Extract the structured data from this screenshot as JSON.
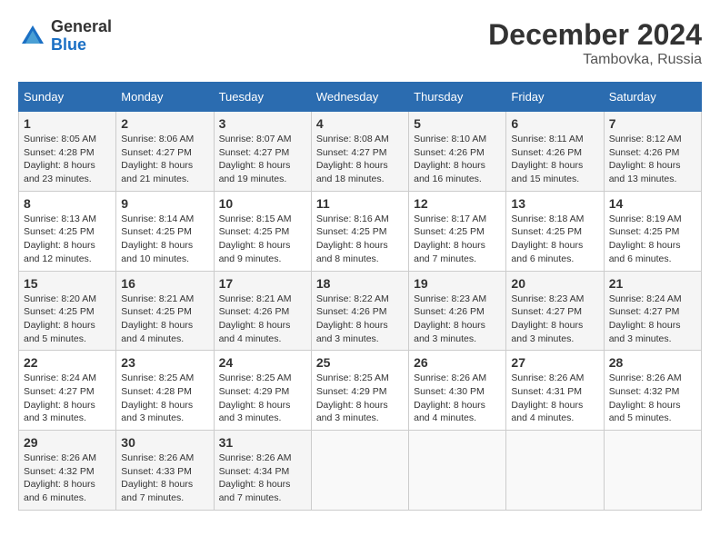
{
  "header": {
    "logo_general": "General",
    "logo_blue": "Blue",
    "month_title": "December 2024",
    "location": "Tambovka, Russia"
  },
  "calendar": {
    "days_of_week": [
      "Sunday",
      "Monday",
      "Tuesday",
      "Wednesday",
      "Thursday",
      "Friday",
      "Saturday"
    ],
    "weeks": [
      [
        {
          "day": "",
          "info": ""
        },
        {
          "day": "2",
          "sunrise": "Sunrise: 8:06 AM",
          "sunset": "Sunset: 4:27 PM",
          "daylight": "Daylight: 8 hours and 21 minutes."
        },
        {
          "day": "3",
          "sunrise": "Sunrise: 8:07 AM",
          "sunset": "Sunset: 4:27 PM",
          "daylight": "Daylight: 8 hours and 19 minutes."
        },
        {
          "day": "4",
          "sunrise": "Sunrise: 8:08 AM",
          "sunset": "Sunset: 4:27 PM",
          "daylight": "Daylight: 8 hours and 18 minutes."
        },
        {
          "day": "5",
          "sunrise": "Sunrise: 8:10 AM",
          "sunset": "Sunset: 4:26 PM",
          "daylight": "Daylight: 8 hours and 16 minutes."
        },
        {
          "day": "6",
          "sunrise": "Sunrise: 8:11 AM",
          "sunset": "Sunset: 4:26 PM",
          "daylight": "Daylight: 8 hours and 15 minutes."
        },
        {
          "day": "7",
          "sunrise": "Sunrise: 8:12 AM",
          "sunset": "Sunset: 4:26 PM",
          "daylight": "Daylight: 8 hours and 13 minutes."
        }
      ],
      [
        {
          "day": "8",
          "sunrise": "Sunrise: 8:13 AM",
          "sunset": "Sunset: 4:25 PM",
          "daylight": "Daylight: 8 hours and 12 minutes."
        },
        {
          "day": "9",
          "sunrise": "Sunrise: 8:14 AM",
          "sunset": "Sunset: 4:25 PM",
          "daylight": "Daylight: 8 hours and 10 minutes."
        },
        {
          "day": "10",
          "sunrise": "Sunrise: 8:15 AM",
          "sunset": "Sunset: 4:25 PM",
          "daylight": "Daylight: 8 hours and 9 minutes."
        },
        {
          "day": "11",
          "sunrise": "Sunrise: 8:16 AM",
          "sunset": "Sunset: 4:25 PM",
          "daylight": "Daylight: 8 hours and 8 minutes."
        },
        {
          "day": "12",
          "sunrise": "Sunrise: 8:17 AM",
          "sunset": "Sunset: 4:25 PM",
          "daylight": "Daylight: 8 hours and 7 minutes."
        },
        {
          "day": "13",
          "sunrise": "Sunrise: 8:18 AM",
          "sunset": "Sunset: 4:25 PM",
          "daylight": "Daylight: 8 hours and 6 minutes."
        },
        {
          "day": "14",
          "sunrise": "Sunrise: 8:19 AM",
          "sunset": "Sunset: 4:25 PM",
          "daylight": "Daylight: 8 hours and 6 minutes."
        }
      ],
      [
        {
          "day": "15",
          "sunrise": "Sunrise: 8:20 AM",
          "sunset": "Sunset: 4:25 PM",
          "daylight": "Daylight: 8 hours and 5 minutes."
        },
        {
          "day": "16",
          "sunrise": "Sunrise: 8:21 AM",
          "sunset": "Sunset: 4:25 PM",
          "daylight": "Daylight: 8 hours and 4 minutes."
        },
        {
          "day": "17",
          "sunrise": "Sunrise: 8:21 AM",
          "sunset": "Sunset: 4:26 PM",
          "daylight": "Daylight: 8 hours and 4 minutes."
        },
        {
          "day": "18",
          "sunrise": "Sunrise: 8:22 AM",
          "sunset": "Sunset: 4:26 PM",
          "daylight": "Daylight: 8 hours and 3 minutes."
        },
        {
          "day": "19",
          "sunrise": "Sunrise: 8:23 AM",
          "sunset": "Sunset: 4:26 PM",
          "daylight": "Daylight: 8 hours and 3 minutes."
        },
        {
          "day": "20",
          "sunrise": "Sunrise: 8:23 AM",
          "sunset": "Sunset: 4:27 PM",
          "daylight": "Daylight: 8 hours and 3 minutes."
        },
        {
          "day": "21",
          "sunrise": "Sunrise: 8:24 AM",
          "sunset": "Sunset: 4:27 PM",
          "daylight": "Daylight: 8 hours and 3 minutes."
        }
      ],
      [
        {
          "day": "22",
          "sunrise": "Sunrise: 8:24 AM",
          "sunset": "Sunset: 4:27 PM",
          "daylight": "Daylight: 8 hours and 3 minutes."
        },
        {
          "day": "23",
          "sunrise": "Sunrise: 8:25 AM",
          "sunset": "Sunset: 4:28 PM",
          "daylight": "Daylight: 8 hours and 3 minutes."
        },
        {
          "day": "24",
          "sunrise": "Sunrise: 8:25 AM",
          "sunset": "Sunset: 4:29 PM",
          "daylight": "Daylight: 8 hours and 3 minutes."
        },
        {
          "day": "25",
          "sunrise": "Sunrise: 8:25 AM",
          "sunset": "Sunset: 4:29 PM",
          "daylight": "Daylight: 8 hours and 3 minutes."
        },
        {
          "day": "26",
          "sunrise": "Sunrise: 8:26 AM",
          "sunset": "Sunset: 4:30 PM",
          "daylight": "Daylight: 8 hours and 4 minutes."
        },
        {
          "day": "27",
          "sunrise": "Sunrise: 8:26 AM",
          "sunset": "Sunset: 4:31 PM",
          "daylight": "Daylight: 8 hours and 4 minutes."
        },
        {
          "day": "28",
          "sunrise": "Sunrise: 8:26 AM",
          "sunset": "Sunset: 4:32 PM",
          "daylight": "Daylight: 8 hours and 5 minutes."
        }
      ],
      [
        {
          "day": "29",
          "sunrise": "Sunrise: 8:26 AM",
          "sunset": "Sunset: 4:32 PM",
          "daylight": "Daylight: 8 hours and 6 minutes."
        },
        {
          "day": "30",
          "sunrise": "Sunrise: 8:26 AM",
          "sunset": "Sunset: 4:33 PM",
          "daylight": "Daylight: 8 hours and 7 minutes."
        },
        {
          "day": "31",
          "sunrise": "Sunrise: 8:26 AM",
          "sunset": "Sunset: 4:34 PM",
          "daylight": "Daylight: 8 hours and 7 minutes."
        },
        {
          "day": "",
          "info": ""
        },
        {
          "day": "",
          "info": ""
        },
        {
          "day": "",
          "info": ""
        },
        {
          "day": "",
          "info": ""
        }
      ]
    ],
    "first_day_num": "1",
    "first_day_sunrise": "Sunrise: 8:05 AM",
    "first_day_sunset": "Sunset: 4:28 PM",
    "first_day_daylight": "Daylight: 8 hours and 23 minutes."
  }
}
